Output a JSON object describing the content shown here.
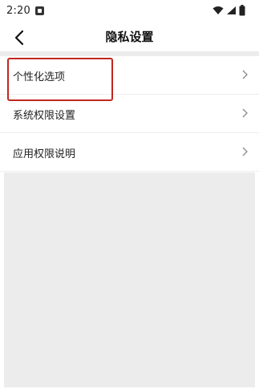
{
  "status": {
    "time": "2:20",
    "icons": [
      "notification-icon",
      "wifi-icon",
      "signal-icon",
      "battery-icon"
    ]
  },
  "nav": {
    "title": "隐私设置",
    "back_icon": "back-arrow-icon"
  },
  "menu": {
    "items": [
      {
        "label": "个性化选项",
        "highlighted": true
      },
      {
        "label": "系统权限设置",
        "highlighted": false
      },
      {
        "label": "应用权限说明",
        "highlighted": false
      }
    ],
    "chevron_icon": "chevron-right-icon"
  },
  "colors": {
    "highlight": "#c0271d",
    "background": "#ececec",
    "surface": "#ffffff"
  }
}
